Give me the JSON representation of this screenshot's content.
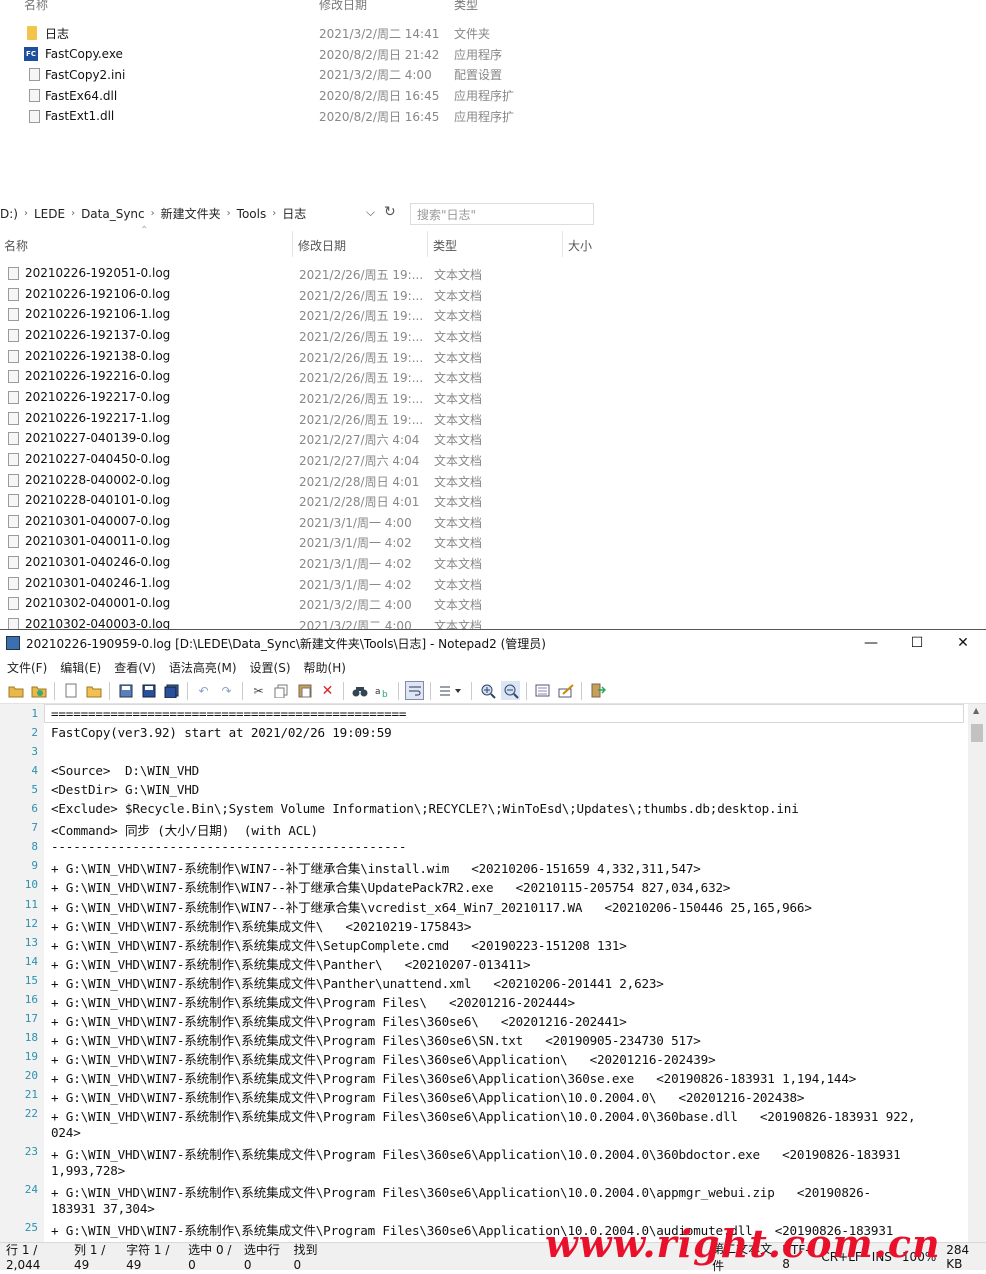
{
  "explorer_top": {
    "headers": {
      "name": "名称",
      "date": "修改日期",
      "type": "类型"
    },
    "rows": [
      {
        "name": "日志",
        "date": "2021/3/2/周二 14:41",
        "type": "文件夹",
        "icon": "folder-icon"
      },
      {
        "name": "FastCopy.exe",
        "date": "2020/8/2/周日 21:42",
        "type": "应用程序",
        "icon": "exe-icon"
      },
      {
        "name": "FastCopy2.ini",
        "date": "2021/3/2/周二 4:00",
        "type": "配置设置",
        "icon": "ini-file-icon"
      },
      {
        "name": "FastEx64.dll",
        "date": "2020/8/2/周日 16:45",
        "type": "应用程序扩",
        "icon": "dll-file-icon"
      },
      {
        "name": "FastExt1.dll",
        "date": "2020/8/2/周日 16:45",
        "type": "应用程序扩",
        "icon": "dll-file-icon"
      }
    ]
  },
  "explorer_log": {
    "breadcrumb": [
      "D:)",
      "LEDE",
      "Data_Sync",
      "新建文件夹",
      "Tools",
      "日志"
    ],
    "search_placeholder": "搜索\"日志\"",
    "headers": {
      "name": "名称",
      "date": "修改日期",
      "type": "类型",
      "size": "大小"
    },
    "rows": [
      {
        "name": "20210226-192051-0.log",
        "date": "2021/2/26/周五 19:...",
        "type": "文本文档"
      },
      {
        "name": "20210226-192106-0.log",
        "date": "2021/2/26/周五 19:...",
        "type": "文本文档"
      },
      {
        "name": "20210226-192106-1.log",
        "date": "2021/2/26/周五 19:...",
        "type": "文本文档"
      },
      {
        "name": "20210226-192137-0.log",
        "date": "2021/2/26/周五 19:...",
        "type": "文本文档"
      },
      {
        "name": "20210226-192138-0.log",
        "date": "2021/2/26/周五 19:...",
        "type": "文本文档"
      },
      {
        "name": "20210226-192216-0.log",
        "date": "2021/2/26/周五 19:...",
        "type": "文本文档"
      },
      {
        "name": "20210226-192217-0.log",
        "date": "2021/2/26/周五 19:...",
        "type": "文本文档"
      },
      {
        "name": "20210226-192217-1.log",
        "date": "2021/2/26/周五 19:...",
        "type": "文本文档"
      },
      {
        "name": "20210227-040139-0.log",
        "date": "2021/2/27/周六 4:04",
        "type": "文本文档"
      },
      {
        "name": "20210227-040450-0.log",
        "date": "2021/2/27/周六 4:04",
        "type": "文本文档"
      },
      {
        "name": "20210228-040002-0.log",
        "date": "2021/2/28/周日 4:01",
        "type": "文本文档"
      },
      {
        "name": "20210228-040101-0.log",
        "date": "2021/2/28/周日 4:01",
        "type": "文本文档"
      },
      {
        "name": "20210301-040007-0.log",
        "date": "2021/3/1/周一 4:00",
        "type": "文本文档"
      },
      {
        "name": "20210301-040011-0.log",
        "date": "2021/3/1/周一 4:02",
        "type": "文本文档"
      },
      {
        "name": "20210301-040246-0.log",
        "date": "2021/3/1/周一 4:02",
        "type": "文本文档"
      },
      {
        "name": "20210301-040246-1.log",
        "date": "2021/3/1/周一 4:02",
        "type": "文本文档"
      },
      {
        "name": "20210302-040001-0.log",
        "date": "2021/3/2/周二 4:00",
        "type": "文本文档"
      },
      {
        "name": "20210302-040003-0.log",
        "date": "2021/3/2/周二 4:00",
        "type": "文本文档"
      }
    ]
  },
  "notepad": {
    "title": "20210226-190959-0.log [D:\\LEDE\\Data_Sync\\新建文件夹\\Tools\\日志] - Notepad2 (管理员)",
    "menu": [
      "文件(F)",
      "编辑(E)",
      "查看(V)",
      "语法高亮(M)",
      "设置(S)",
      "帮助(H)"
    ],
    "lines": [
      {
        "n": "1",
        "t": "================================================"
      },
      {
        "n": "2",
        "t": "FastCopy(ver3.92) start at 2021/02/26 19:09:59"
      },
      {
        "n": "3",
        "t": ""
      },
      {
        "n": "4",
        "t": "<Source>  D:\\WIN_VHD"
      },
      {
        "n": "5",
        "t": "<DestDir> G:\\WIN_VHD"
      },
      {
        "n": "6",
        "t": "<Exclude> $Recycle.Bin\\;System Volume Information\\;RECYCLE?\\;WinToEsd\\;Updates\\;thumbs.db;desktop.ini"
      },
      {
        "n": "7",
        "t": "<Command> 同步 (大小/日期)  (with ACL)"
      },
      {
        "n": "8",
        "t": "------------------------------------------------"
      },
      {
        "n": "9",
        "t": "+ G:\\WIN_VHD\\WIN7-系统制作\\WIN7--补丁继承合集\\install.wim   <20210206-151659 4,332,311,547>"
      },
      {
        "n": "10",
        "t": "+ G:\\WIN_VHD\\WIN7-系统制作\\WIN7--补丁继承合集\\UpdatePack7R2.exe   <20210115-205754 827,034,632>"
      },
      {
        "n": "11",
        "t": "+ G:\\WIN_VHD\\WIN7-系统制作\\WIN7--补丁继承合集\\vcredist_x64_Win7_20210117.WA   <20210206-150446 25,165,966>"
      },
      {
        "n": "12",
        "t": "+ G:\\WIN_VHD\\WIN7-系统制作\\系统集成文件\\   <20210219-175843>"
      },
      {
        "n": "13",
        "t": "+ G:\\WIN_VHD\\WIN7-系统制作\\系统集成文件\\SetupComplete.cmd   <20190223-151208 131>"
      },
      {
        "n": "14",
        "t": "+ G:\\WIN_VHD\\WIN7-系统制作\\系统集成文件\\Panther\\   <20210207-013411>"
      },
      {
        "n": "15",
        "t": "+ G:\\WIN_VHD\\WIN7-系统制作\\系统集成文件\\Panther\\unattend.xml   <20210206-201441 2,623>"
      },
      {
        "n": "16",
        "t": "+ G:\\WIN_VHD\\WIN7-系统制作\\系统集成文件\\Program Files\\   <20201216-202444>"
      },
      {
        "n": "17",
        "t": "+ G:\\WIN_VHD\\WIN7-系统制作\\系统集成文件\\Program Files\\360se6\\   <20201216-202441>"
      },
      {
        "n": "18",
        "t": "+ G:\\WIN_VHD\\WIN7-系统制作\\系统集成文件\\Program Files\\360se6\\SN.txt   <20190905-234730 517>"
      },
      {
        "n": "19",
        "t": "+ G:\\WIN_VHD\\WIN7-系统制作\\系统集成文件\\Program Files\\360se6\\Application\\   <20201216-202439>"
      },
      {
        "n": "20",
        "t": "+ G:\\WIN_VHD\\WIN7-系统制作\\系统集成文件\\Program Files\\360se6\\Application\\360se.exe   <20190826-183931 1,194,144>"
      },
      {
        "n": "21",
        "t": "+ G:\\WIN_VHD\\WIN7-系统制作\\系统集成文件\\Program Files\\360se6\\Application\\10.0.2004.0\\   <20201216-202438>"
      },
      {
        "n": "22",
        "t": "+ G:\\WIN_VHD\\WIN7-系统制作\\系统集成文件\\Program Files\\360se6\\Application\\10.0.2004.0\\360base.dll   <20190826-183931 922,"
      },
      {
        "n": "",
        "t": "024>"
      },
      {
        "n": "23",
        "t": "+ G:\\WIN_VHD\\WIN7-系统制作\\系统集成文件\\Program Files\\360se6\\Application\\10.0.2004.0\\360bdoctor.exe   <20190826-183931"
      },
      {
        "n": "",
        "t": "1,993,728>"
      },
      {
        "n": "24",
        "t": "+ G:\\WIN_VHD\\WIN7-系统制作\\系统集成文件\\Program Files\\360se6\\Application\\10.0.2004.0\\appmgr_webui.zip   <20190826-"
      },
      {
        "n": "",
        "t": "183931 37,304>"
      },
      {
        "n": "25",
        "t": "+ G:\\WIN_VHD\\WIN7-系统制作\\系统集成文件\\Program Files\\360se6\\Application\\10.0.2004.0\\audiomute.dll   <20190826-183931"
      }
    ],
    "status": [
      "行 1 / 2,044",
      "列 1 / 49",
      "字符 1 / 49",
      "选中 0 / 0",
      "选中行 0",
      "找到 0",
      "第二文本文件",
      "UTF-8",
      "CR+LF",
      "INS",
      "100%",
      "284 KB"
    ]
  },
  "watermark": "www.right.com.cn"
}
